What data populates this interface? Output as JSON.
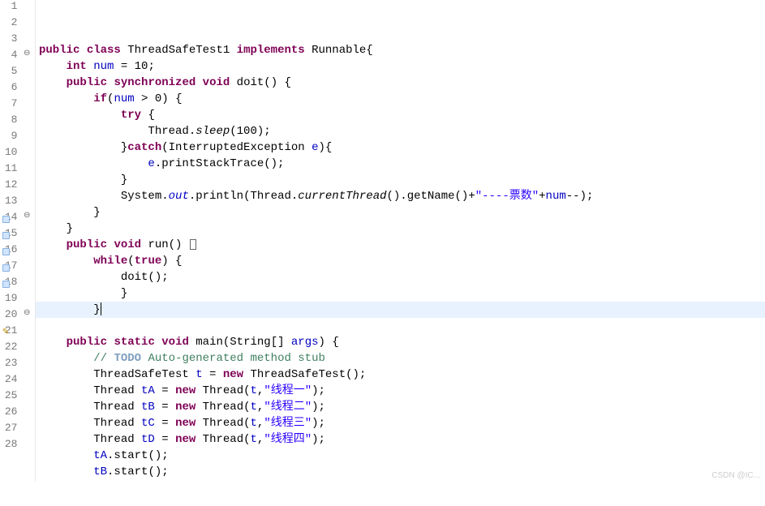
{
  "watermark": "CSDN @IC...",
  "lines": [
    {
      "num": "1",
      "ann": "",
      "marker": "",
      "tokens": []
    },
    {
      "num": "2",
      "ann": "",
      "marker": "",
      "tokens": [
        [
          "kw",
          "public"
        ],
        [
          "plain",
          " "
        ],
        [
          "kw",
          "class"
        ],
        [
          "plain",
          " ThreadSafeTest1 "
        ],
        [
          "kw",
          "implements"
        ],
        [
          "plain",
          " Runnable{"
        ]
      ]
    },
    {
      "num": "3",
      "ann": "",
      "marker": "",
      "tokens": [
        [
          "plain",
          "    "
        ],
        [
          "kw",
          "int"
        ],
        [
          "plain",
          " "
        ],
        [
          "field",
          "num"
        ],
        [
          "plain",
          " = 10;"
        ]
      ]
    },
    {
      "num": "4",
      "ann": "⊖",
      "marker": "",
      "tokens": [
        [
          "plain",
          "    "
        ],
        [
          "kw",
          "public"
        ],
        [
          "plain",
          " "
        ],
        [
          "kw",
          "synchronized"
        ],
        [
          "plain",
          " "
        ],
        [
          "kw",
          "void"
        ],
        [
          "plain",
          " doit() {"
        ]
      ]
    },
    {
      "num": "5",
      "ann": "",
      "marker": "",
      "tokens": [
        [
          "plain",
          "        "
        ],
        [
          "kw",
          "if"
        ],
        [
          "plain",
          "("
        ],
        [
          "field",
          "num"
        ],
        [
          "plain",
          " > 0) {"
        ]
      ]
    },
    {
      "num": "6",
      "ann": "",
      "marker": "",
      "tokens": [
        [
          "plain",
          "            "
        ],
        [
          "kw",
          "try"
        ],
        [
          "plain",
          " {"
        ]
      ]
    },
    {
      "num": "7",
      "ann": "",
      "marker": "",
      "tokens": [
        [
          "plain",
          "                Thread."
        ],
        [
          "static-method",
          "sleep"
        ],
        [
          "plain",
          "(100);"
        ]
      ]
    },
    {
      "num": "8",
      "ann": "",
      "marker": "",
      "tokens": [
        [
          "plain",
          "            }"
        ],
        [
          "kw",
          "catch"
        ],
        [
          "plain",
          "(InterruptedException "
        ],
        [
          "field",
          "e"
        ],
        [
          "plain",
          "){"
        ]
      ]
    },
    {
      "num": "9",
      "ann": "",
      "marker": "",
      "tokens": [
        [
          "plain",
          "                "
        ],
        [
          "field",
          "e"
        ],
        [
          "plain",
          ".printStackTrace();"
        ]
      ]
    },
    {
      "num": "10",
      "ann": "",
      "marker": "",
      "tokens": [
        [
          "plain",
          "            }"
        ]
      ]
    },
    {
      "num": "11",
      "ann": "",
      "marker": "",
      "tokens": [
        [
          "plain",
          "            System."
        ],
        [
          "static-field",
          "out"
        ],
        [
          "plain",
          ".println(Thread."
        ],
        [
          "static-method",
          "currentThread"
        ],
        [
          "plain",
          "().getName()+"
        ],
        [
          "str",
          "\"----票数\""
        ],
        [
          "plain",
          "+"
        ],
        [
          "field",
          "num"
        ],
        [
          "plain",
          "--);"
        ]
      ]
    },
    {
      "num": "12",
      "ann": "",
      "marker": "",
      "tokens": [
        [
          "plain",
          "        }"
        ]
      ]
    },
    {
      "num": "13",
      "ann": "",
      "marker": "",
      "tokens": [
        [
          "plain",
          "    }"
        ]
      ]
    },
    {
      "num": "14",
      "ann": "⊖",
      "marker": "blue",
      "tokens": [
        [
          "plain",
          "    "
        ],
        [
          "kw",
          "public"
        ],
        [
          "plain",
          " "
        ],
        [
          "kw",
          "void"
        ],
        [
          "plain",
          " run() "
        ],
        [
          "box",
          ""
        ]
      ]
    },
    {
      "num": "15",
      "ann": "",
      "marker": "blue",
      "tokens": [
        [
          "plain",
          "        "
        ],
        [
          "kw",
          "while"
        ],
        [
          "plain",
          "("
        ],
        [
          "kw",
          "true"
        ],
        [
          "plain",
          ") {"
        ]
      ]
    },
    {
      "num": "16",
      "ann": "",
      "marker": "blue",
      "tokens": [
        [
          "plain",
          "            doit();"
        ]
      ]
    },
    {
      "num": "17",
      "ann": "",
      "marker": "blue",
      "tokens": [
        [
          "plain",
          "            }"
        ]
      ]
    },
    {
      "num": "18",
      "ann": "",
      "marker": "blue",
      "highlight": true,
      "tokens": [
        [
          "plain",
          "        }"
        ],
        [
          "cursor",
          ""
        ]
      ]
    },
    {
      "num": "19",
      "ann": "",
      "marker": "",
      "tokens": []
    },
    {
      "num": "20",
      "ann": "⊖",
      "marker": "",
      "tokens": [
        [
          "plain",
          "    "
        ],
        [
          "kw",
          "public"
        ],
        [
          "plain",
          " "
        ],
        [
          "kw",
          "static"
        ],
        [
          "plain",
          " "
        ],
        [
          "kw",
          "void"
        ],
        [
          "plain",
          " main(String[] "
        ],
        [
          "field",
          "args"
        ],
        [
          "plain",
          ") {"
        ]
      ]
    },
    {
      "num": "21",
      "ann": "",
      "marker": "warn",
      "tokens": [
        [
          "plain",
          "        "
        ],
        [
          "comment",
          "// "
        ],
        [
          "todo",
          "TODO"
        ],
        [
          "comment",
          " Auto-generated method stub"
        ]
      ]
    },
    {
      "num": "22",
      "ann": "",
      "marker": "",
      "tokens": [
        [
          "plain",
          "        ThreadSafeTest "
        ],
        [
          "field",
          "t"
        ],
        [
          "plain",
          " = "
        ],
        [
          "kw",
          "new"
        ],
        [
          "plain",
          " ThreadSafeTest();"
        ]
      ]
    },
    {
      "num": "23",
      "ann": "",
      "marker": "",
      "tokens": [
        [
          "plain",
          "        Thread "
        ],
        [
          "field",
          "tA"
        ],
        [
          "plain",
          " = "
        ],
        [
          "kw",
          "new"
        ],
        [
          "plain",
          " Thread("
        ],
        [
          "field",
          "t"
        ],
        [
          "plain",
          ","
        ],
        [
          "str",
          "\"线程一\""
        ],
        [
          "plain",
          ");"
        ]
      ]
    },
    {
      "num": "24",
      "ann": "",
      "marker": "",
      "tokens": [
        [
          "plain",
          "        Thread "
        ],
        [
          "field",
          "tB"
        ],
        [
          "plain",
          " = "
        ],
        [
          "kw",
          "new"
        ],
        [
          "plain",
          " Thread("
        ],
        [
          "field",
          "t"
        ],
        [
          "plain",
          ","
        ],
        [
          "str",
          "\"线程二\""
        ],
        [
          "plain",
          ");"
        ]
      ]
    },
    {
      "num": "25",
      "ann": "",
      "marker": "",
      "tokens": [
        [
          "plain",
          "        Thread "
        ],
        [
          "field",
          "tC"
        ],
        [
          "plain",
          " = "
        ],
        [
          "kw",
          "new"
        ],
        [
          "plain",
          " Thread("
        ],
        [
          "field",
          "t"
        ],
        [
          "plain",
          ","
        ],
        [
          "str",
          "\"线程三\""
        ],
        [
          "plain",
          ");"
        ]
      ]
    },
    {
      "num": "26",
      "ann": "",
      "marker": "",
      "tokens": [
        [
          "plain",
          "        Thread "
        ],
        [
          "field",
          "tD"
        ],
        [
          "plain",
          " = "
        ],
        [
          "kw",
          "new"
        ],
        [
          "plain",
          " Thread("
        ],
        [
          "field",
          "t"
        ],
        [
          "plain",
          ","
        ],
        [
          "str",
          "\"线程四\""
        ],
        [
          "plain",
          ");"
        ]
      ]
    },
    {
      "num": "27",
      "ann": "",
      "marker": "",
      "tokens": [
        [
          "plain",
          "        "
        ],
        [
          "field",
          "tA"
        ],
        [
          "plain",
          ".start();"
        ]
      ]
    },
    {
      "num": "28",
      "ann": "",
      "marker": "",
      "tokens": [
        [
          "plain",
          "        "
        ],
        [
          "field",
          "tB"
        ],
        [
          "plain",
          ".start();"
        ]
      ]
    }
  ]
}
